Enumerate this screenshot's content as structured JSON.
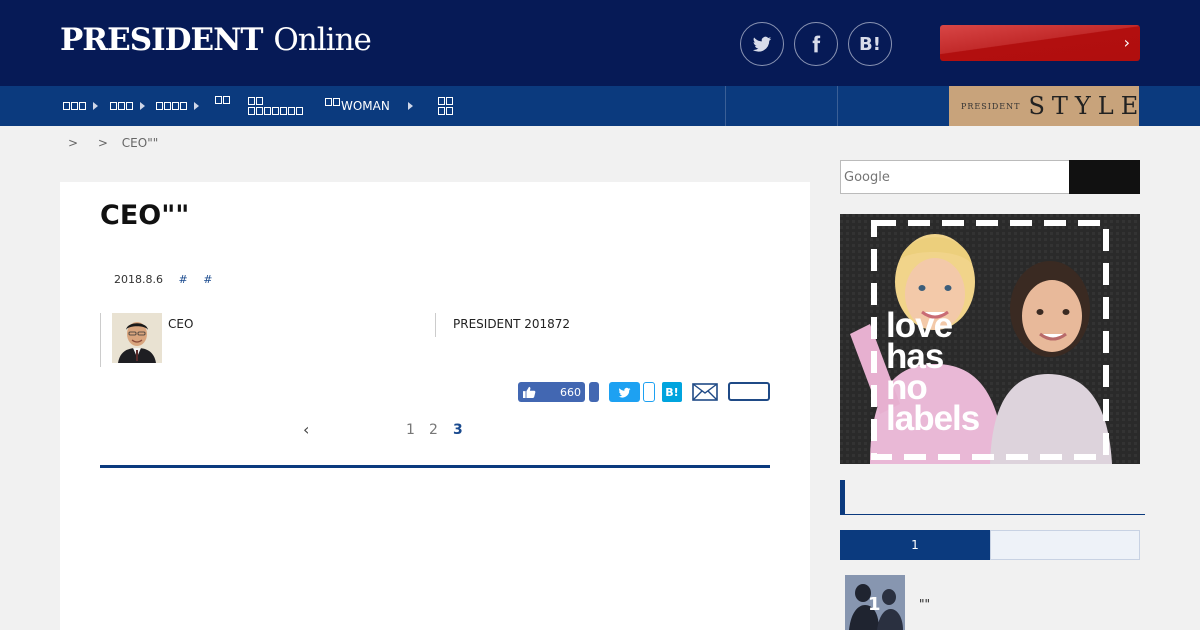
{
  "header": {
    "logo_main": "PRESIDENT",
    "logo_sub": "Online",
    "social": {
      "twitter": "twitter-icon",
      "facebook": "facebook-icon",
      "hatena_label": "B!"
    },
    "cta_label": "",
    "cta_chevron": "›"
  },
  "nav": {
    "items": [
      {
        "label": "□□□"
      },
      {
        "label": "□□□"
      },
      {
        "label": "□□□□"
      },
      {
        "label": ""
      },
      {
        "label": "□□□□□"
      },
      {
        "label": "WOMAN"
      },
      {
        "label": ""
      }
    ],
    "style_banner": {
      "small": "PRESIDENT",
      "large": "STYLE"
    }
  },
  "breadcrumb": {
    "sep1": ">",
    "sep2": ">",
    "current": "CEO\"\""
  },
  "article": {
    "title": "CEO\"\"",
    "date": "2018.8.6",
    "tags": [
      "#",
      "#"
    ],
    "author_role": "CEO",
    "source": "PRESIDENT 201872",
    "fb_like_count": "660",
    "hatena_label": "B!",
    "pager": {
      "prev": "‹",
      "pages": [
        "1",
        "2",
        "3"
      ],
      "current": "3"
    }
  },
  "sidebar": {
    "search_placeholder": "Google",
    "ad": {
      "line1": "love",
      "line2": "has",
      "line3": "no",
      "line4": "labels"
    },
    "ranking": {
      "tab_active": "1",
      "tab_inactive": "",
      "first_rank": "1",
      "first_title": "\"\""
    }
  },
  "colors": {
    "header_bg": "#061a56",
    "nav_bg": "#0b3a7e",
    "cta": "#b20f0f",
    "style_gold": "#c8a37b"
  }
}
